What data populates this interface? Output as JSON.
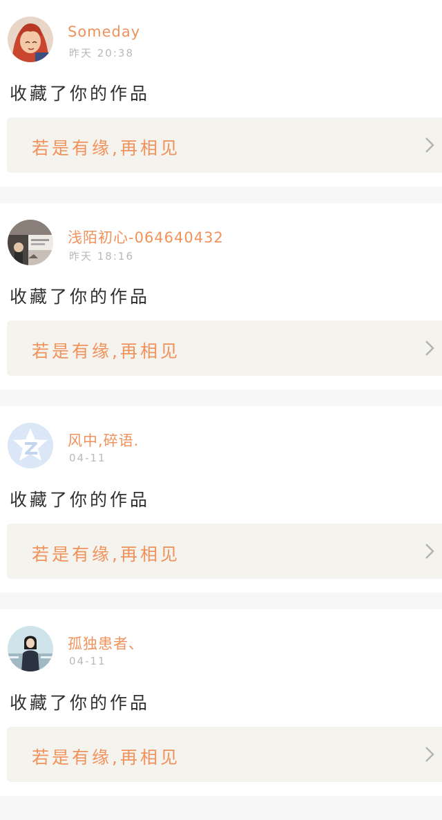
{
  "colors": {
    "page_bg": "#f7f7f7",
    "card_bg": "#ffffff",
    "username": "#f0925c",
    "timestamp": "#b9b9b9",
    "action_text": "#2f2f2f",
    "work_bg": "#f4f3ee",
    "work_title": "#f0925c",
    "chevron": "#b3b3b3"
  },
  "notifications": [
    {
      "avatar_icon": "anime-red-hair-avatar",
      "username": "Someday",
      "time": "昨天 20:38",
      "action": "收藏了你的作品",
      "work_title": "若是有缘,再相见",
      "chevron_icon": "chevron-right-icon"
    },
    {
      "avatar_icon": "photo-collage-avatar",
      "username": "浅陌初心-064640432",
      "time": "昨天 18:16",
      "action": "收藏了你的作品",
      "work_title": "若是有缘,再相见",
      "chevron_icon": "chevron-right-icon"
    },
    {
      "avatar_icon": "qzone-default-avatar",
      "username": "风中,碎语.",
      "time": "04-11",
      "action": "收藏了你的作品",
      "work_title": "若是有缘,再相见",
      "chevron_icon": "chevron-right-icon"
    },
    {
      "avatar_icon": "girl-photo-avatar",
      "username": "孤独患者、",
      "time": "04-11",
      "action": "收藏了你的作品",
      "work_title": "若是有缘,再相见",
      "chevron_icon": "chevron-right-icon"
    }
  ]
}
